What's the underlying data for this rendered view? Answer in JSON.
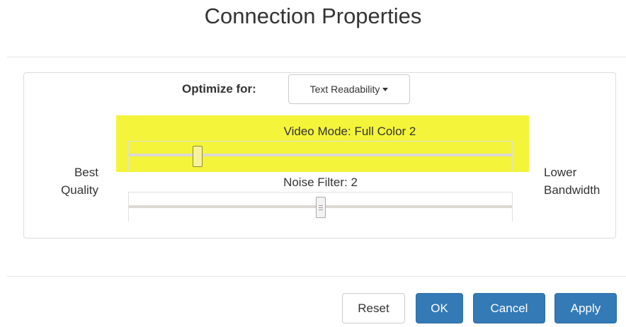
{
  "dialog": {
    "title": "Connection Properties"
  },
  "optimize": {
    "label": "Optimize for:",
    "selected": "Text Readability"
  },
  "video_mode": {
    "label": "Video Mode: Full Color 2",
    "value_fraction": 0.17
  },
  "noise_filter": {
    "label": "Noise Filter: 2",
    "value_fraction": 0.5
  },
  "scale": {
    "left_line1": "Best",
    "left_line2": "Quality",
    "right_line1": "Lower",
    "right_line2": "Bandwidth"
  },
  "buttons": {
    "reset": "Reset",
    "ok": "OK",
    "cancel": "Cancel",
    "apply": "Apply"
  },
  "colors": {
    "highlight": "#f4f43a",
    "primary": "#337ab7"
  }
}
